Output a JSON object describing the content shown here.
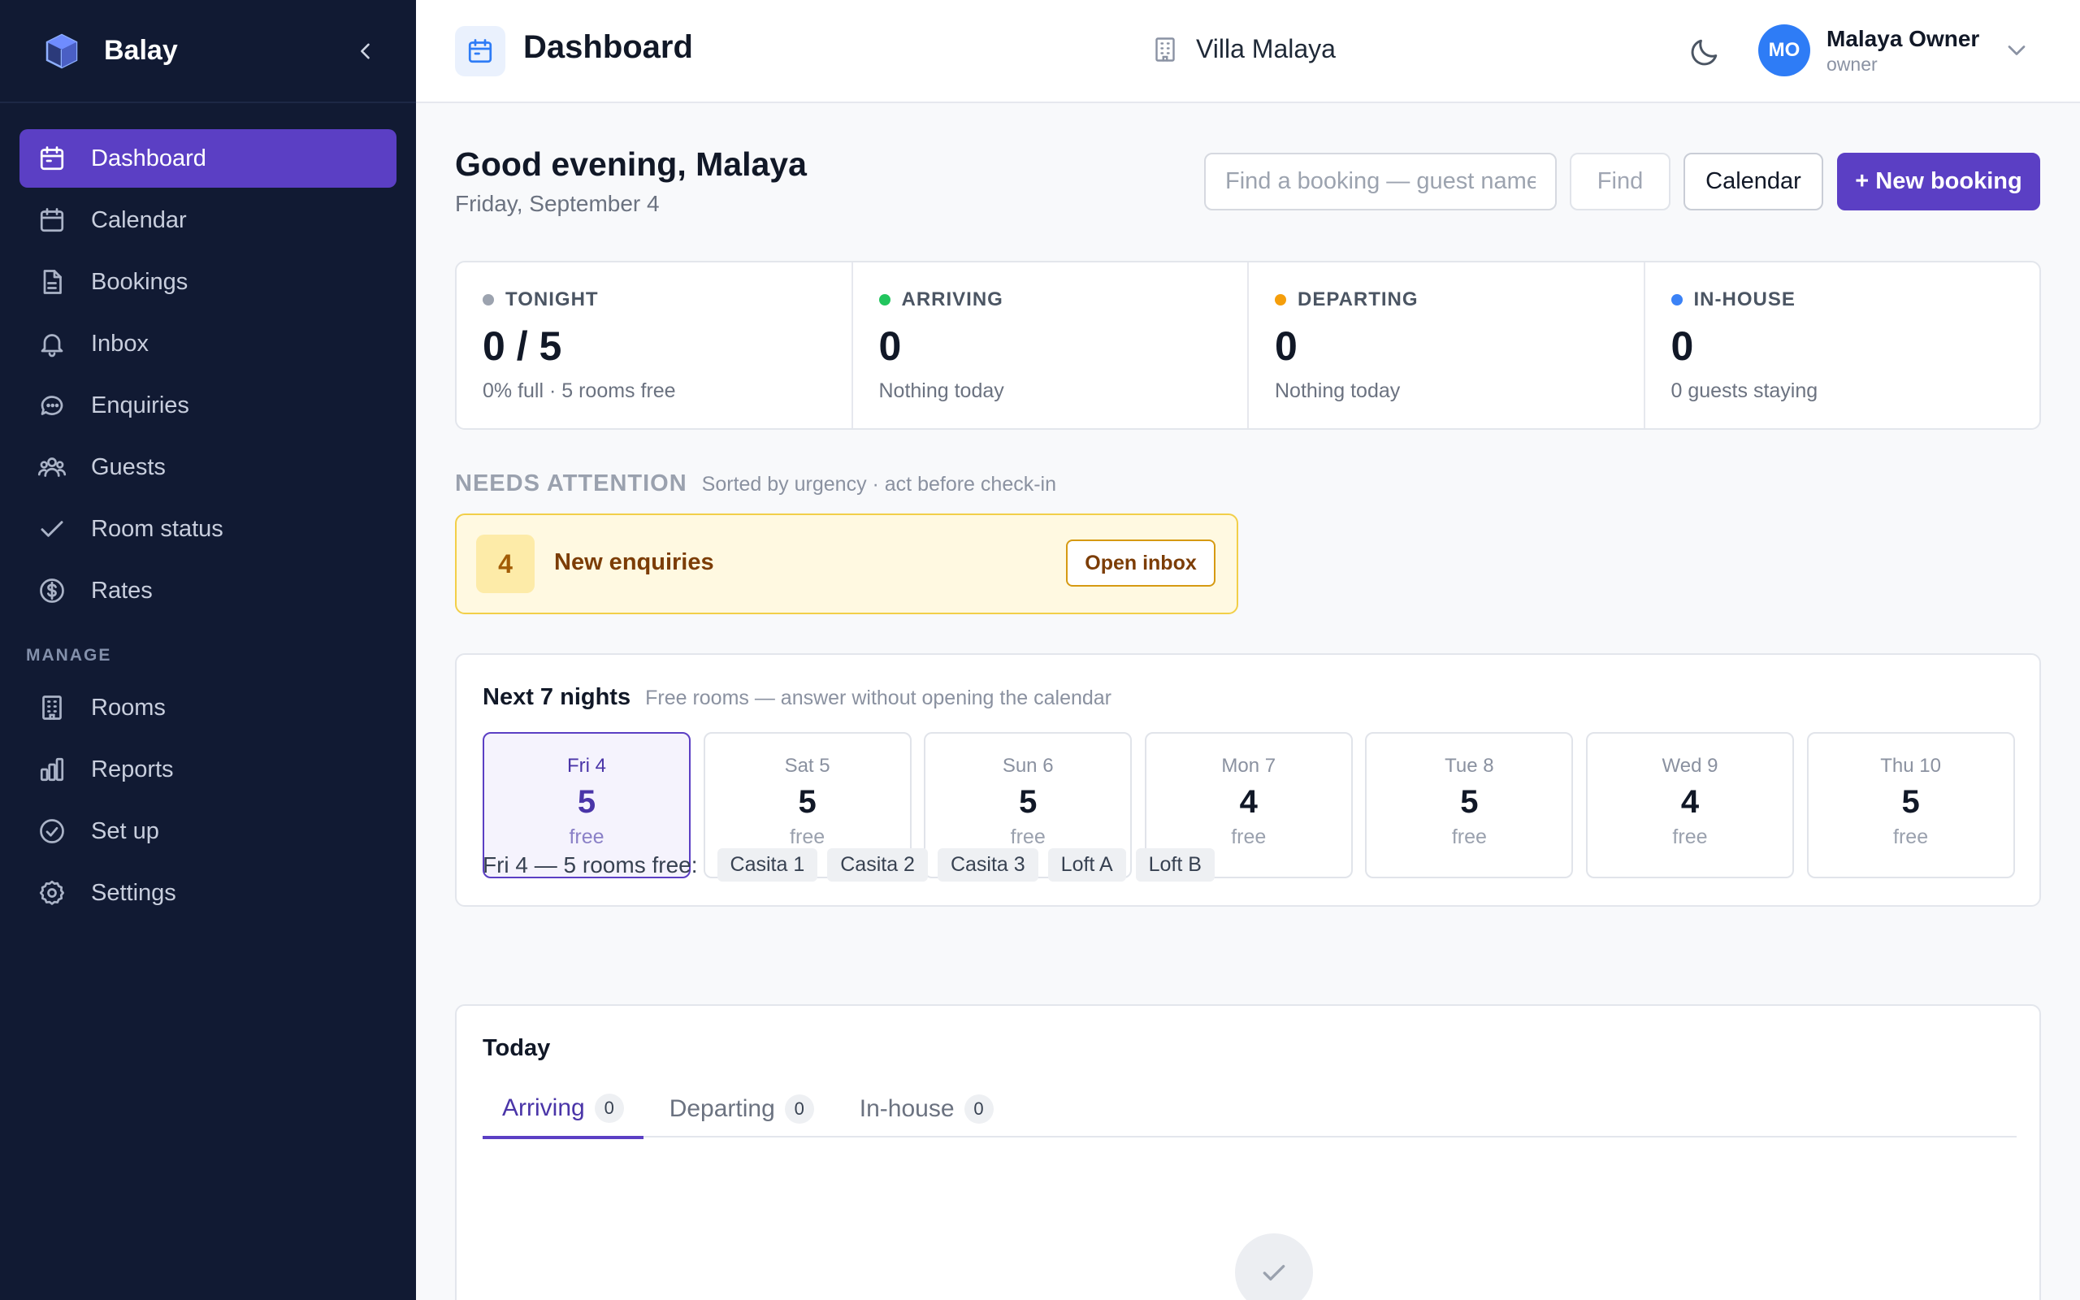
{
  "brand": {
    "name": "Balay"
  },
  "sidebar": {
    "items": [
      {
        "label": "Dashboard",
        "icon": "calendar-icon",
        "active": true
      },
      {
        "label": "Calendar",
        "icon": "calendar-icon"
      },
      {
        "label": "Bookings",
        "icon": "document-icon"
      },
      {
        "label": "Inbox",
        "icon": "bell-icon"
      },
      {
        "label": "Enquiries",
        "icon": "chat-icon"
      },
      {
        "label": "Guests",
        "icon": "users-icon"
      },
      {
        "label": "Room status",
        "icon": "check-icon"
      },
      {
        "label": "Rates",
        "icon": "dollar-icon"
      }
    ],
    "section_manage": "MANAGE",
    "manage_items": [
      {
        "label": "Rooms",
        "icon": "building-icon"
      },
      {
        "label": "Reports",
        "icon": "bar-chart-icon"
      },
      {
        "label": "Set up",
        "icon": "check-circle-icon"
      },
      {
        "label": "Settings",
        "icon": "gear-icon"
      }
    ]
  },
  "header": {
    "title": "Dashboard",
    "property": "Villa Malaya",
    "user": {
      "initials": "MO",
      "name": "Malaya Owner",
      "role": "owner"
    }
  },
  "main": {
    "greeting": "Good evening, Malaya",
    "date": "Friday, September 4",
    "search_placeholder": "Find a booking — guest name",
    "find_label": "Find",
    "calendar_label": "Calendar",
    "new_booking_label": "+ New booking"
  },
  "stats": [
    {
      "label": "TONIGHT",
      "value": "0 / 5",
      "sub": "0% full · 5 rooms free",
      "color": "#9ca3af"
    },
    {
      "label": "ARRIVING",
      "value": "0",
      "sub": "Nothing today",
      "color": "#22c55e"
    },
    {
      "label": "DEPARTING",
      "value": "0",
      "sub": "Nothing today",
      "color": "#f59e0b"
    },
    {
      "label": "IN-HOUSE",
      "value": "0",
      "sub": "0 guests staying",
      "color": "#3b82f6"
    }
  ],
  "attention": {
    "title": "NEEDS ATTENTION",
    "subtitle": "Sorted by urgency · act before check-in",
    "count": "4",
    "label": "New enquiries",
    "button": "Open inbox"
  },
  "nights": {
    "title": "Next 7 nights",
    "subtitle": "Free rooms — answer without opening the calendar",
    "days": [
      {
        "name": "Fri 4",
        "count": "5",
        "free": "free",
        "selected": true
      },
      {
        "name": "Sat 5",
        "count": "5",
        "free": "free"
      },
      {
        "name": "Sun 6",
        "count": "5",
        "free": "free"
      },
      {
        "name": "Mon 7",
        "count": "4",
        "free": "free"
      },
      {
        "name": "Tue 8",
        "count": "5",
        "free": "free"
      },
      {
        "name": "Wed 9",
        "count": "4",
        "free": "free"
      },
      {
        "name": "Thu 10",
        "count": "5",
        "free": "free"
      }
    ],
    "free_label": "Fri 4 — 5 rooms free:",
    "rooms": [
      "Casita 1",
      "Casita 2",
      "Casita 3",
      "Loft A",
      "Loft B"
    ]
  },
  "today": {
    "title": "Today",
    "tabs": [
      {
        "label": "Arriving",
        "count": "0",
        "active": true
      },
      {
        "label": "Departing",
        "count": "0"
      },
      {
        "label": "In-house",
        "count": "0"
      }
    ]
  },
  "colors": {
    "accent": "#5b3fc4",
    "sidebar": "#111a33",
    "warning_bg": "#fff9e1",
    "warning_border": "#f2cf49"
  }
}
